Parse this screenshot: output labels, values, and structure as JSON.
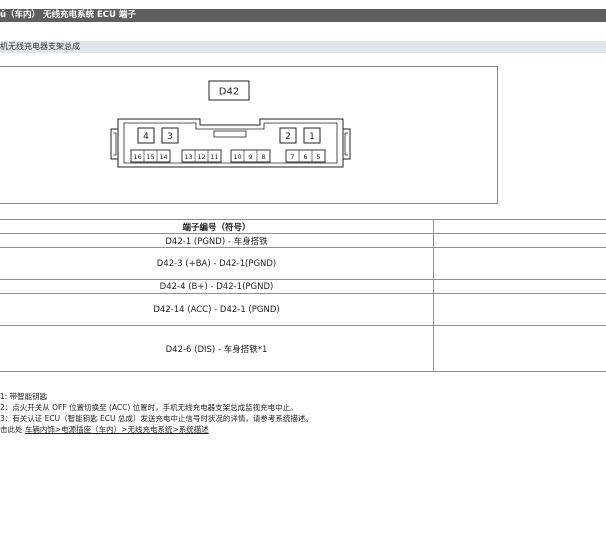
{
  "page": {
    "title": "ǔ（车内） 无线充电系统 ECU 端子",
    "section": "机无线充电器支架总成"
  },
  "diagram": {
    "connector_label": "D42",
    "pins_top": [
      "4",
      "3",
      "2",
      "1"
    ],
    "pins_bottom": [
      "16",
      "15",
      "14",
      "13",
      "12",
      "11",
      "10",
      "9",
      "8",
      "7",
      "6",
      "5"
    ]
  },
  "table": {
    "header": "端子编号（符号）",
    "rows": [
      "D42-1 (PGND) - 车身搭铁",
      "D42-3 (+BA) - D42-1(PGND)",
      "D42-4 (B+) - D42-1(PGND)",
      "D42-14 (ACC) - D42-1 (PGND)",
      "D42-6 (DIS) - 车身搭铁*1"
    ]
  },
  "notes": {
    "note1": "1: 带智能钥匙",
    "note2": "2：点火开关从 OFF 位置切换至 (ACC) 位置时，手机无线充电器支架总成监视充电中止。",
    "note3": "3：有关认证 ECU（智能钥匙 ECU 总成）发送充电中止信号时状况的详情，请参考系统描述。",
    "note4_prefix": "击此处",
    "note4_link": "车辆内饰>电源插座（车内）>无线充电系统>系统描述"
  }
}
